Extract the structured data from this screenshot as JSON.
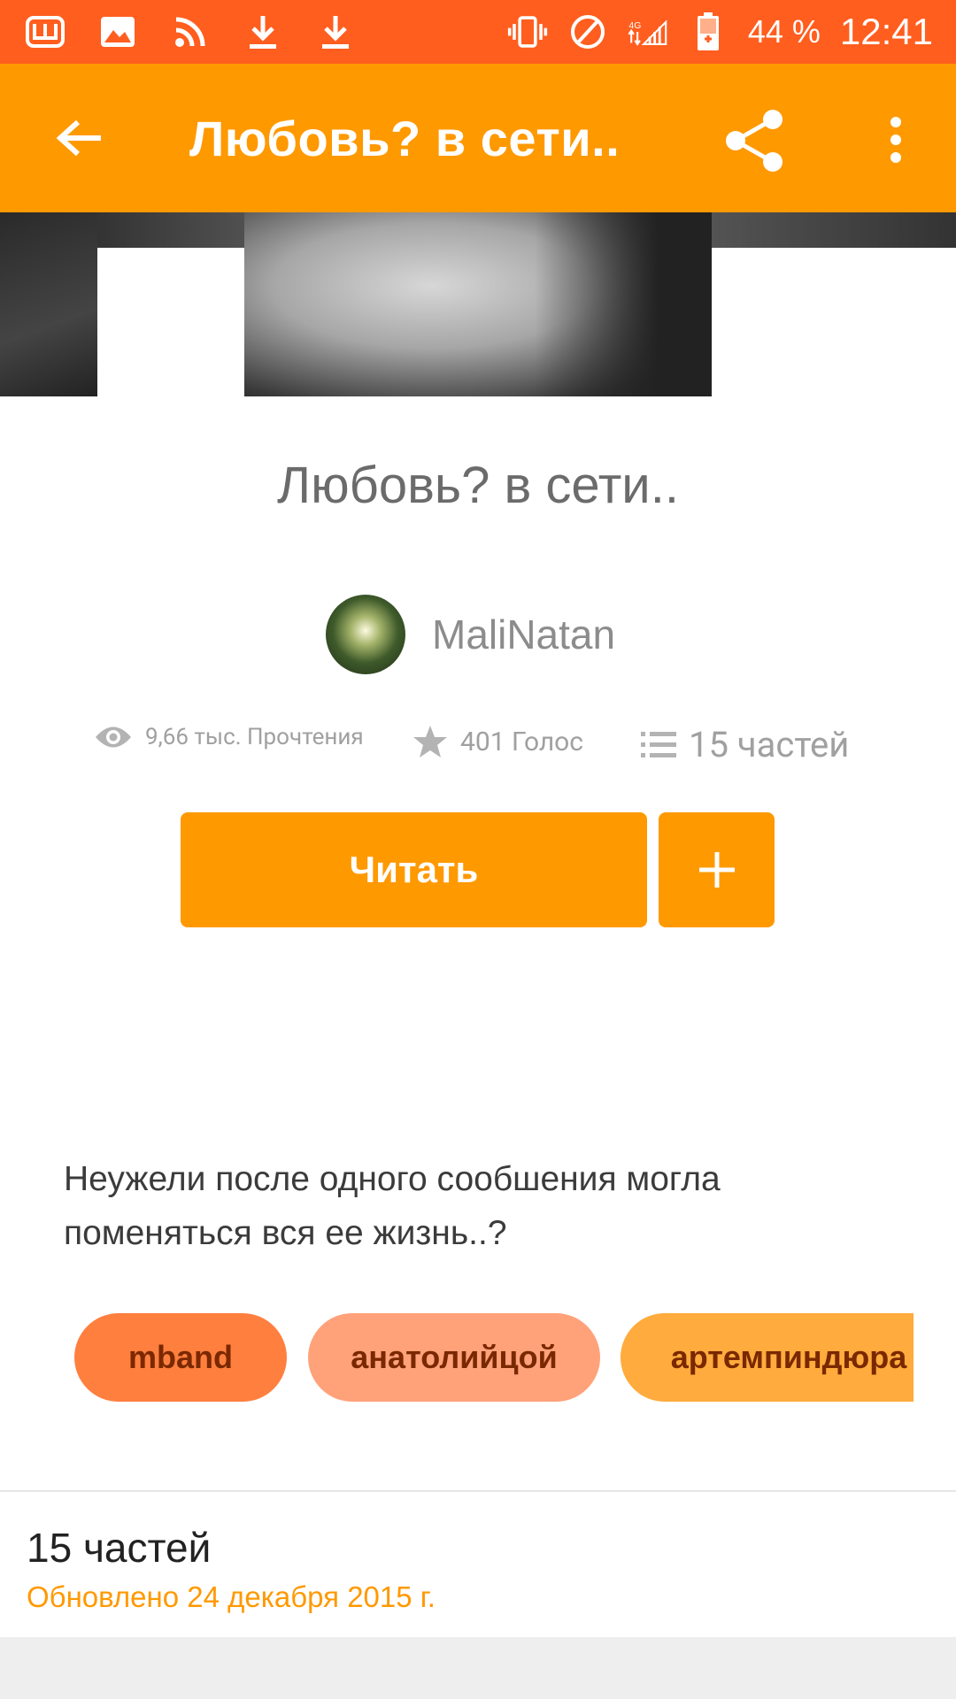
{
  "status_bar": {
    "battery_text": "44 %",
    "time": "12:41",
    "network": "4G"
  },
  "app_bar": {
    "title": "Любовь? в сети.."
  },
  "story": {
    "title": "Любовь? в сети..",
    "author": "MaliNatan",
    "stats": {
      "reads": "9,66 тыс. Прочтения",
      "votes": "401 Голос",
      "parts": "15 частей"
    },
    "read_button": "Читать",
    "description": "Неужели после одного сообшения могла поменяться вся ее жизнь..?",
    "tags": [
      "mband",
      "анатолийцой",
      "артемпиндюра"
    ]
  },
  "parts_section": {
    "count": "15 частей",
    "updated": "Обновлено 24 декабря 2015 г."
  },
  "colors": {
    "status_bar": "#ff5e1f",
    "app_bar": "#ff9900",
    "accent": "#ff9900"
  }
}
